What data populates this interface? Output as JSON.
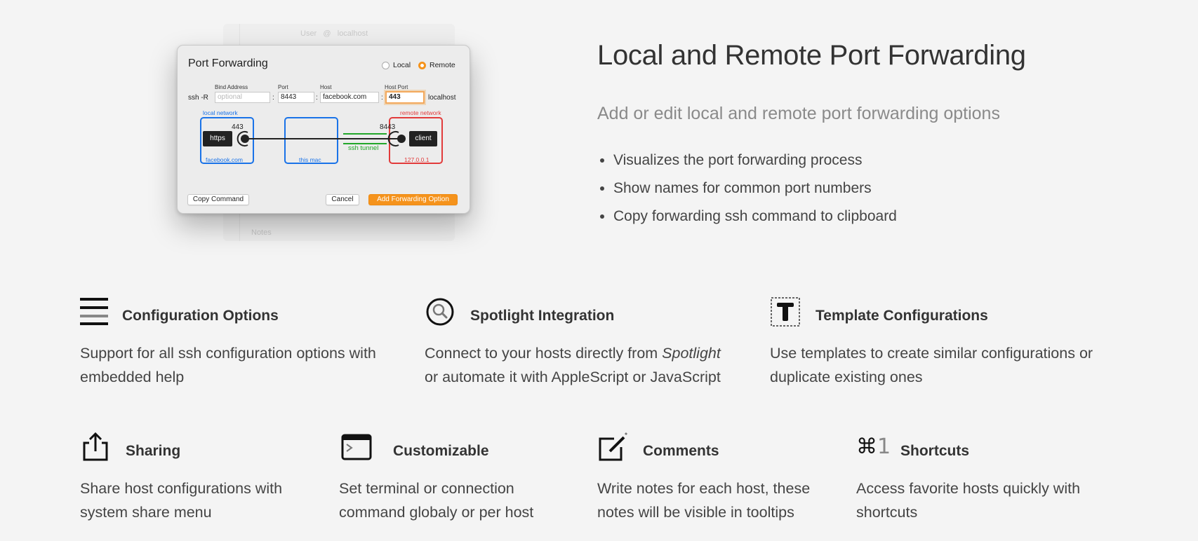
{
  "screenshot": {
    "background_window": {
      "user_label": "User",
      "at": "@",
      "host_value": "localhost",
      "notes_label": "Notes"
    },
    "dialog": {
      "title": "Port Forwarding",
      "radio_local": "Local",
      "radio_remote": "Remote",
      "selected": "Remote",
      "labels": {
        "bind_address": "Bind Address",
        "port": "Port",
        "host": "Host",
        "host_port": "Host Port"
      },
      "command_prefix": "ssh -R",
      "bind_placeholder": "optional",
      "port_value": "8443",
      "host_value": "facebook.com",
      "host_port_value": "443",
      "destination": "localhost",
      "colon": ":",
      "diagram": {
        "left_caption": "local network",
        "left_tag": "https",
        "left_port": "443",
        "left_host": "facebook.com",
        "middle_caption": "this mac",
        "tunnel_caption": "ssh tunnel",
        "right_caption": "remote network",
        "right_tag": "client",
        "right_port": "8443",
        "right_host": "127.0.0.1"
      },
      "buttons": {
        "copy": "Copy Command",
        "cancel": "Cancel",
        "add": "Add Forwarding Option"
      }
    }
  },
  "hero": {
    "title": "Local and Remote Port Forwarding",
    "subtitle": "Add or edit local and remote port forwarding options",
    "bullets": [
      "Visualizes the port forwarding process",
      "Show names for common port numbers",
      "Copy forwarding ssh command to clipboard"
    ]
  },
  "features_row1": [
    {
      "title": "Configuration Options",
      "icon": "list-icon",
      "desc": "Support for all ssh configuration options with embedded help"
    },
    {
      "title": "Spotlight Integration",
      "icon": "spotlight-icon",
      "desc_pre": "Connect to your hosts directly from ",
      "desc_em": "Spotlight",
      "desc_post": "or automate it with AppleScript or JavaScript"
    },
    {
      "title": "Template Configurations",
      "icon": "template-icon",
      "desc": "Use templates to create similar configurations or duplicate existing ones"
    }
  ],
  "features_row2": [
    {
      "title": "Sharing",
      "icon": "share-icon",
      "desc": "Share host configurations with system share menu"
    },
    {
      "title": "Customizable",
      "icon": "terminal-icon",
      "desc": "Set terminal or connection command globaly or per host"
    },
    {
      "title": "Comments",
      "icon": "comment-edit-icon",
      "desc": "Write notes for each host, these notes will be visible in tooltips"
    },
    {
      "title": "Shortcuts",
      "icon": "command-key-icon",
      "icon_text_cmd": "⌘",
      "icon_text_num": "1",
      "desc": "Access favorite hosts quickly with shortcuts"
    }
  ],
  "colors": {
    "accent": "#f5931c",
    "blue": "#1a73e8",
    "red": "#e23b3b",
    "green": "#22a72a"
  }
}
